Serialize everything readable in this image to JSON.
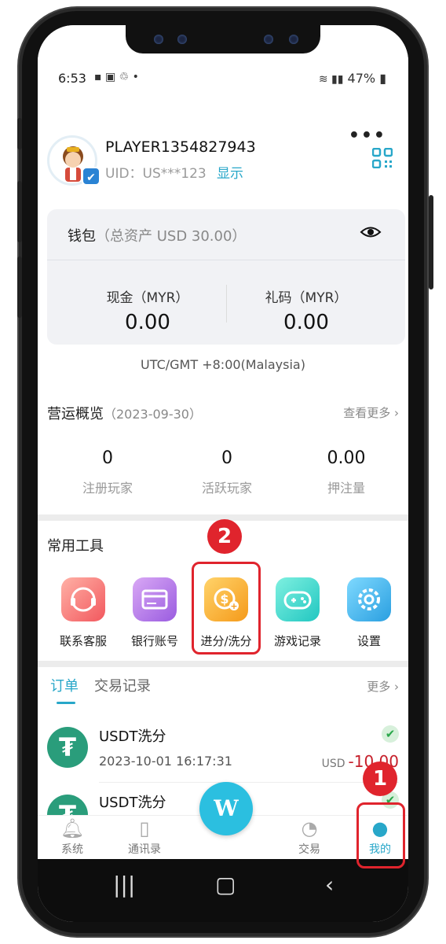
{
  "status": {
    "time": "6:53",
    "left_icons": "▪ ▣ ♲ •",
    "battery": "47%"
  },
  "header": {
    "player_name": "PLAYER1354827943",
    "uid_label": "UID：US***123",
    "uid_toggle": "显示"
  },
  "wallet": {
    "title": "钱包",
    "total": "（总资产 USD 30.00）",
    "cash_label": "现金（MYR）",
    "cash_value": "0.00",
    "gift_label": "礼码（MYR）",
    "gift_value": "0.00",
    "timezone": "UTC/GMT +8:00(Malaysia)"
  },
  "overview": {
    "title": "营运概览",
    "date": "（2023-09-30）",
    "more": "查看更多",
    "stats": [
      {
        "value": "0",
        "label": "注册玩家"
      },
      {
        "value": "0",
        "label": "活跃玩家"
      },
      {
        "value": "0.00",
        "label": "押注量"
      }
    ]
  },
  "tools": {
    "title": "常用工具",
    "items": [
      {
        "label": "联系客服",
        "icon": "headset-icon"
      },
      {
        "label": "银行账号",
        "icon": "card-icon"
      },
      {
        "label": "进分/洗分",
        "icon": "coin-icon"
      },
      {
        "label": "游戏记录",
        "icon": "gamepad-icon"
      },
      {
        "label": "设置",
        "icon": "gear-icon"
      }
    ]
  },
  "orders": {
    "tab_active": "订单",
    "tab_inactive": "交易记录",
    "more": "更多",
    "rows": [
      {
        "title": "USDT洗分",
        "date": "2023-10-01 16:17:31",
        "currency": "USD",
        "amount": "-10.00"
      },
      {
        "title": "USDT洗分"
      }
    ]
  },
  "bottom_nav": {
    "items": [
      "系统",
      "通讯录",
      "交易",
      "我的"
    ],
    "center_label": "W"
  },
  "annotations": {
    "step1": "1",
    "step2": "2"
  },
  "colors": {
    "accent": "#28a7c9",
    "highlight": "#e0242d",
    "usdt": "#2a9d7b"
  }
}
